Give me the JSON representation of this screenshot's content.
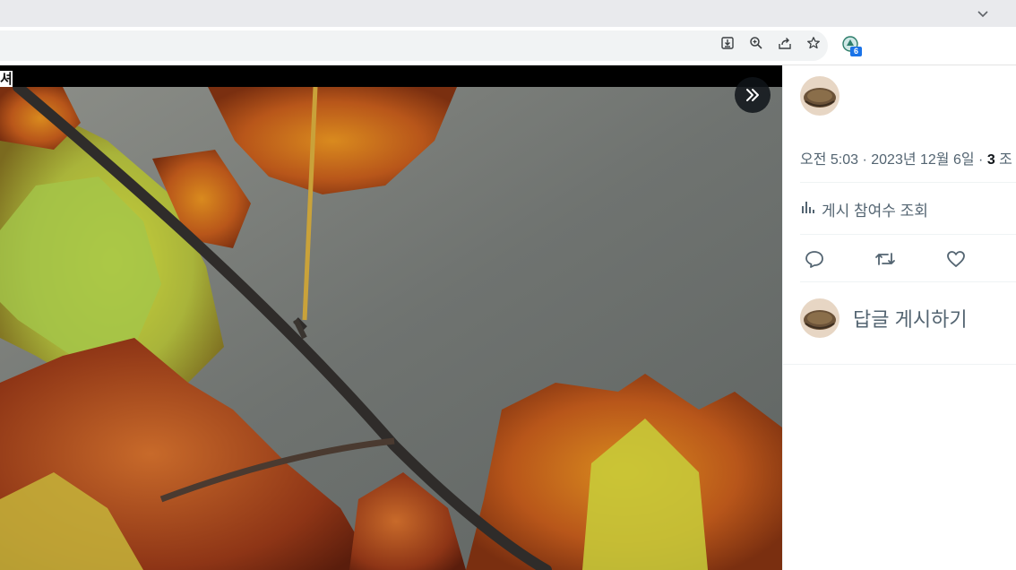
{
  "browser": {
    "icons": [
      "install-icon",
      "zoom-icon",
      "share-icon",
      "bookmark-star-icon",
      "extension-icon",
      "tab-list-chevron-icon"
    ],
    "extension_badge": "6"
  },
  "media": {
    "caption_fragment": "셔",
    "expand_icon": "double-chevron-right-icon"
  },
  "post": {
    "timestamp": "오전 5:03 · 2023년 12월 6일 · ",
    "view_count": "3",
    "view_label": " 조",
    "analytics_label": "게시 참여수 조회",
    "action_icons": [
      "reply-icon",
      "repost-icon",
      "like-icon"
    ],
    "reply_placeholder": "답글 게시하기"
  },
  "colors": {
    "chrome_bg": "#e9eaed",
    "text_secondary": "#536471",
    "accent_badge": "#1a73e8"
  }
}
